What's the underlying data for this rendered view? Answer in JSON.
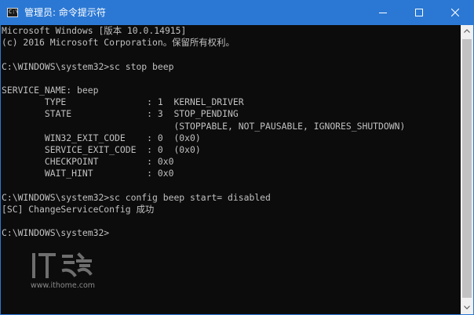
{
  "window": {
    "title": "管理员: 命令提示符",
    "icon": "cmd-icon",
    "controls": [
      "minimize-icon",
      "maximize-icon",
      "close-icon"
    ]
  },
  "console": {
    "lines": [
      "Microsoft Windows [版本 10.0.14915]",
      "(c) 2016 Microsoft Corporation。保留所有权利。",
      "",
      "C:\\WINDOWS\\system32>sc stop beep",
      "",
      "SERVICE_NAME: beep",
      "        TYPE               : 1  KERNEL_DRIVER",
      "        STATE              : 3  STOP_PENDING",
      "                                (STOPPABLE, NOT_PAUSABLE, IGNORES_SHUTDOWN)",
      "        WIN32_EXIT_CODE    : 0  (0x0)",
      "        SERVICE_EXIT_CODE  : 0  (0x0)",
      "        CHECKPOINT         : 0x0",
      "        WAIT_HINT          : 0x0",
      "",
      "C:\\WINDOWS\\system32>sc config beep start= disabled",
      "[SC] ChangeServiceConfig 成功",
      "",
      "C:\\WINDOWS\\system32>"
    ]
  },
  "watermark": {
    "logo_text": "IT之家",
    "url": "www.ithome.com"
  },
  "colors": {
    "titlebar": "#2b78d4",
    "console_bg": "#0c0c0c",
    "console_text": "#c0c0c0",
    "scrollbar_bg": "#f0f0f0",
    "scrollbar_thumb": "#c2c2c2"
  }
}
